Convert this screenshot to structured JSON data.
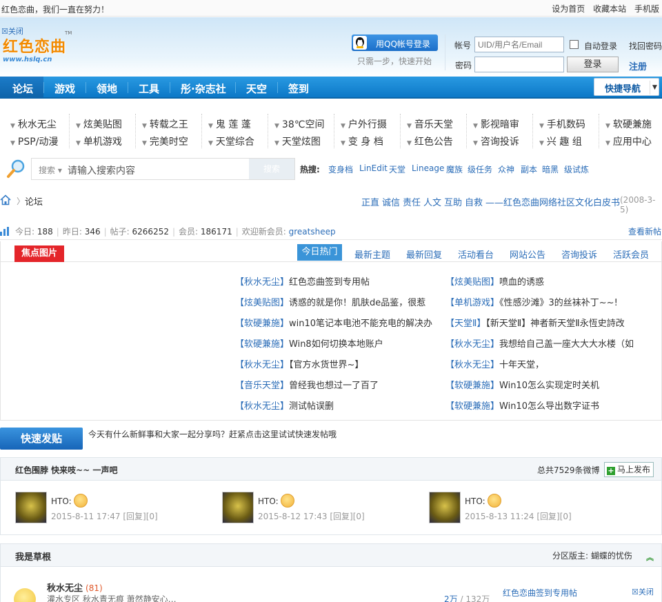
{
  "topbar": {
    "slogan": "红色恋曲，我们一直在努力！",
    "links": [
      "设为首页",
      "收藏本站",
      "手机版"
    ]
  },
  "header": {
    "close_label": "☒关闭",
    "logo_cn": "红色恋曲",
    "logo_en": "www.hslq.cn",
    "logo_tm": "TM",
    "qq_label": "用QQ帐号登录",
    "qq_sub": "只需一步，快速开始",
    "account_label": "帐号",
    "account_placeholder": "UID/用户名/Email",
    "password_label": "密码",
    "autologin_label": "自动登录",
    "forgot_label": "找回密码",
    "login_label": "登录",
    "register_label": "注册"
  },
  "nav": {
    "items": [
      "论坛",
      "游戏",
      "领地",
      "工具",
      "彤·杂志社",
      "天空",
      "签到"
    ],
    "quicknav_label": "快捷导航"
  },
  "subnav": {
    "row1": [
      "秋水无尘",
      "炫美贴图",
      "转载之王",
      "鬼 莲 蓬",
      "38℃空间",
      "户外行摄",
      "音乐天堂",
      "影视暗审",
      "手机数码",
      "软硬兼施"
    ],
    "row2": [
      "PSP/动漫",
      "单机游戏",
      "完美时空",
      "天堂综合",
      "天堂炫图",
      "变 身 档",
      "红色公告",
      "咨询投诉",
      "兴 趣 组",
      "应用中心"
    ]
  },
  "search": {
    "type_label": "搜索",
    "query": "请输入搜索内容",
    "button_label": "搜索",
    "hot_label": "热搜:",
    "hot": [
      "变身档",
      "LinEdit",
      "天堂",
      "Lineage",
      "魔族",
      "级任务",
      "众神",
      "副本",
      "暗黑",
      "级试炼"
    ]
  },
  "breadcrumb": {
    "home_icon": "home-icon",
    "arrow": "〉",
    "forum": "论坛",
    "motto": [
      "正直",
      "诚信",
      "责任",
      "人文",
      "互助",
      "自救",
      "——红色恋曲网络社区文化白皮书"
    ],
    "date": "(2008-3-5)"
  },
  "stats": {
    "today_label": "今日:",
    "today": "188",
    "yesterday_label": "昨日:",
    "yesterday": "346",
    "posts_label": "帖子:",
    "posts": "6266252",
    "members_label": "会员:",
    "members": "186171",
    "welcome_label": "欢迎新会员:",
    "newest": "greatsheep",
    "new_posts_link": "查看新帖"
  },
  "focus": {
    "title": "焦点图片",
    "tabs": [
      "今日热门",
      "最新主题",
      "最新回复",
      "活动看台",
      "网站公告",
      "咨询投诉",
      "活跃会员"
    ],
    "left_posts": [
      {
        "board": "【秋水无尘】",
        "title": "红色恋曲签到专用帖"
      },
      {
        "board": "【炫美贴图】",
        "title": "诱惑的就是你！肌肤de品鉴，很惹"
      },
      {
        "board": "【软硬兼施】",
        "title": "win10笔记本电池不能充电的解决办"
      },
      {
        "board": "【软硬兼施】",
        "title": "Win8如何切换本地账户"
      },
      {
        "board": "【秋水无尘】",
        "title": "【官方水货世界~】"
      },
      {
        "board": "【音乐天堂】",
        "title": "曾经我也想过一了百了"
      },
      {
        "board": "【秋水无尘】",
        "title": "测试帖误删"
      }
    ],
    "right_posts": [
      {
        "board": "【炫美贴图】",
        "title": "喷血的诱惑"
      },
      {
        "board": "【单机游戏】",
        "title": "《性感沙滩》3的丝袜补丁~~!"
      },
      {
        "board": "【天堂Ⅱ】",
        "title": "【新天堂Ⅱ】神者新天堂Ⅱ永恆史詩改"
      },
      {
        "board": "【秋水无尘】",
        "title": "我想给自己盖一座大大大水楼（如"
      },
      {
        "board": "【秋水无尘】",
        "title": "十年天堂，"
      },
      {
        "board": "【软硬兼施】",
        "title": "Win10怎么实现定时关机"
      },
      {
        "board": "【软硬兼施】",
        "title": "Win10怎么导出数字证书"
      }
    ]
  },
  "quickpost": {
    "button_label": "快速发贴",
    "text": "今天有什么新鲜事和大家一起分享吗？赶紧点击这里试试快速发帖哦"
  },
  "weibo": {
    "title": "红色围脖  快来吱~~ 一声吧",
    "count_text": "总共7529条微博",
    "publish_label": "马上发布",
    "entries": [
      {
        "name": "HTO:",
        "time": "2015-8-11 17:47",
        "reply": "[回复][0]"
      },
      {
        "name": "HTO:",
        "time": "2015-8-12 17:43",
        "reply": "[回复][0]"
      },
      {
        "name": "HTO:",
        "time": "2015-8-13 11:24",
        "reply": "[回复][0]"
      }
    ]
  },
  "category": {
    "title": "我是草根",
    "moderator": "分区版主: 蝴蝶的忧伤",
    "forum_name": "秋水无尘",
    "forum_today": "(81)",
    "forum_desc": "灌水专区  秋水青无痕  萧然静安心…",
    "threads": "2万",
    "posts": "132万",
    "last_post": "红色恋曲签到专用帖",
    "close_label": "☒关闭"
  },
  "colors": {
    "nav_blue": "#0c78c7",
    "link_blue": "#2b6db8",
    "focus_red": "#e4252a"
  }
}
